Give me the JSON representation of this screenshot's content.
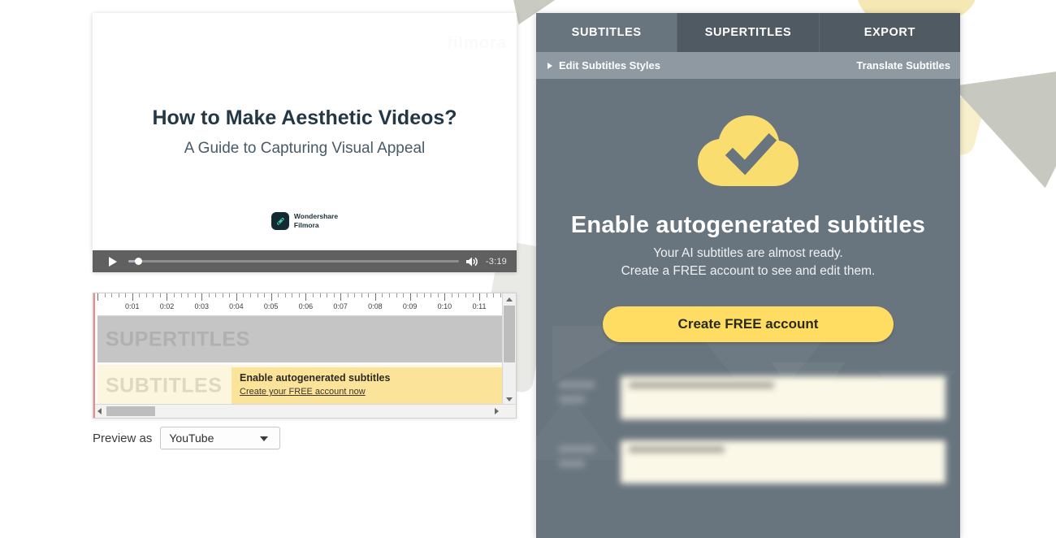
{
  "video_preview": {
    "watermark": "filmora",
    "title": "How to Make Aesthetic Videos?",
    "subtitle": "A Guide to Capturing Visual Appeal",
    "brand_line1": "Wondershare",
    "brand_line2": "Filmora"
  },
  "player": {
    "play_label": "play",
    "time_remaining": "-3:19",
    "progress_percent": 3,
    "volume_label": "volume"
  },
  "timeline": {
    "ruler_labels": [
      "0:01",
      "0:02",
      "0:03",
      "0:04",
      "0:05",
      "0:06",
      "0:07",
      "0:08",
      "0:09",
      "0:10",
      "0:11"
    ],
    "tracks": [
      {
        "name": "SUPERTITLES",
        "label": "SUPERTITLES"
      },
      {
        "name": "SUBTITLES",
        "label": "SUBTITLES"
      }
    ],
    "clip": {
      "title": "Enable autogenerated subtitles",
      "link": "Create your FREE account now"
    }
  },
  "preview_as": {
    "label": "Preview as",
    "value": "YouTube",
    "options": [
      "YouTube"
    ]
  },
  "panel": {
    "tabs": [
      {
        "label": "SUBTITLES",
        "active": true
      },
      {
        "label": "SUPERTITLES",
        "active": false
      },
      {
        "label": "EXPORT",
        "active": false
      }
    ],
    "toolbar": {
      "edit_styles": "Edit Subtitles Styles",
      "translate": "Translate Subtitles"
    },
    "hero": {
      "icon": "cloud-check-icon",
      "title": "Enable autogenerated subtitles",
      "line1": "Your AI subtitles are almost ready.",
      "line2": "Create a FREE account to see and edit them.",
      "cta": "Create FREE account"
    }
  },
  "colors": {
    "panel_bg": "#69757e",
    "tab_inactive": "#4f5a62",
    "toolbar_bg": "#8e99a1",
    "accent_yellow": "#ffdd63",
    "cloud_yellow": "#f9dd6e",
    "clip_yellow": "#fbe49a",
    "track_sub_bg": "#fdf6de",
    "track_super_bg": "#c5c5c5",
    "slide_title": "#243746",
    "player_bg": "#606060",
    "playhead": "#e88b8b"
  }
}
